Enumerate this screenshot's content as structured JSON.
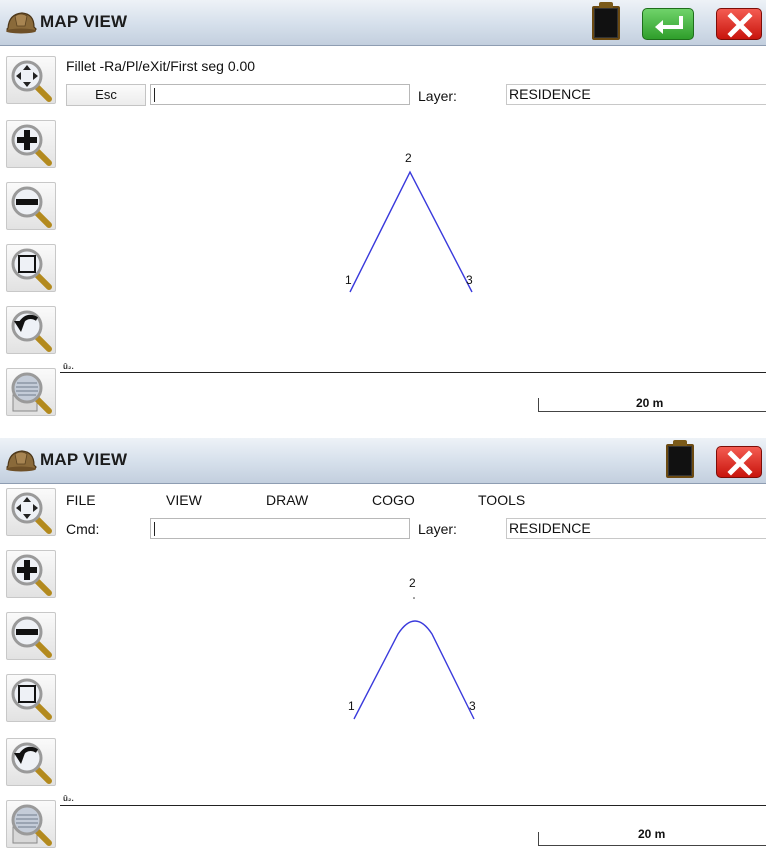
{
  "top": {
    "title": "MAP VIEW",
    "prompt": "Fillet  -Ra/Pl/eXit/First seg 0.00",
    "esc_label": "Esc",
    "layer_label": "Layer:",
    "layer_value": "RESIDENCE",
    "points": [
      "1",
      "2",
      "3"
    ],
    "scale_label": "20 m",
    "axis_mark": "û₂."
  },
  "bottom": {
    "title": "MAP VIEW",
    "menu": [
      "FILE",
      "VIEW",
      "DRAW",
      "COGO",
      "TOOLS"
    ],
    "cmd_label": "Cmd:",
    "layer_label": "Layer:",
    "layer_value": "RESIDENCE",
    "points": [
      "1",
      "2",
      "3"
    ],
    "scale_label": "20 m",
    "axis_mark": "û₂."
  },
  "icons": {
    "helmet": "hard-hat-icon",
    "clipboard": "black-clipboard-icon",
    "enter": "green-enter-icon",
    "close": "red-x-icon",
    "tools": [
      "pan-zoom-icon",
      "zoom-in-icon",
      "zoom-out-icon",
      "zoom-window-icon",
      "zoom-previous-icon",
      "zoom-extents-icon"
    ]
  },
  "colors": {
    "line": "#3a3adc",
    "green_button": "#2f9e2b",
    "red_button": "#d3160f"
  }
}
